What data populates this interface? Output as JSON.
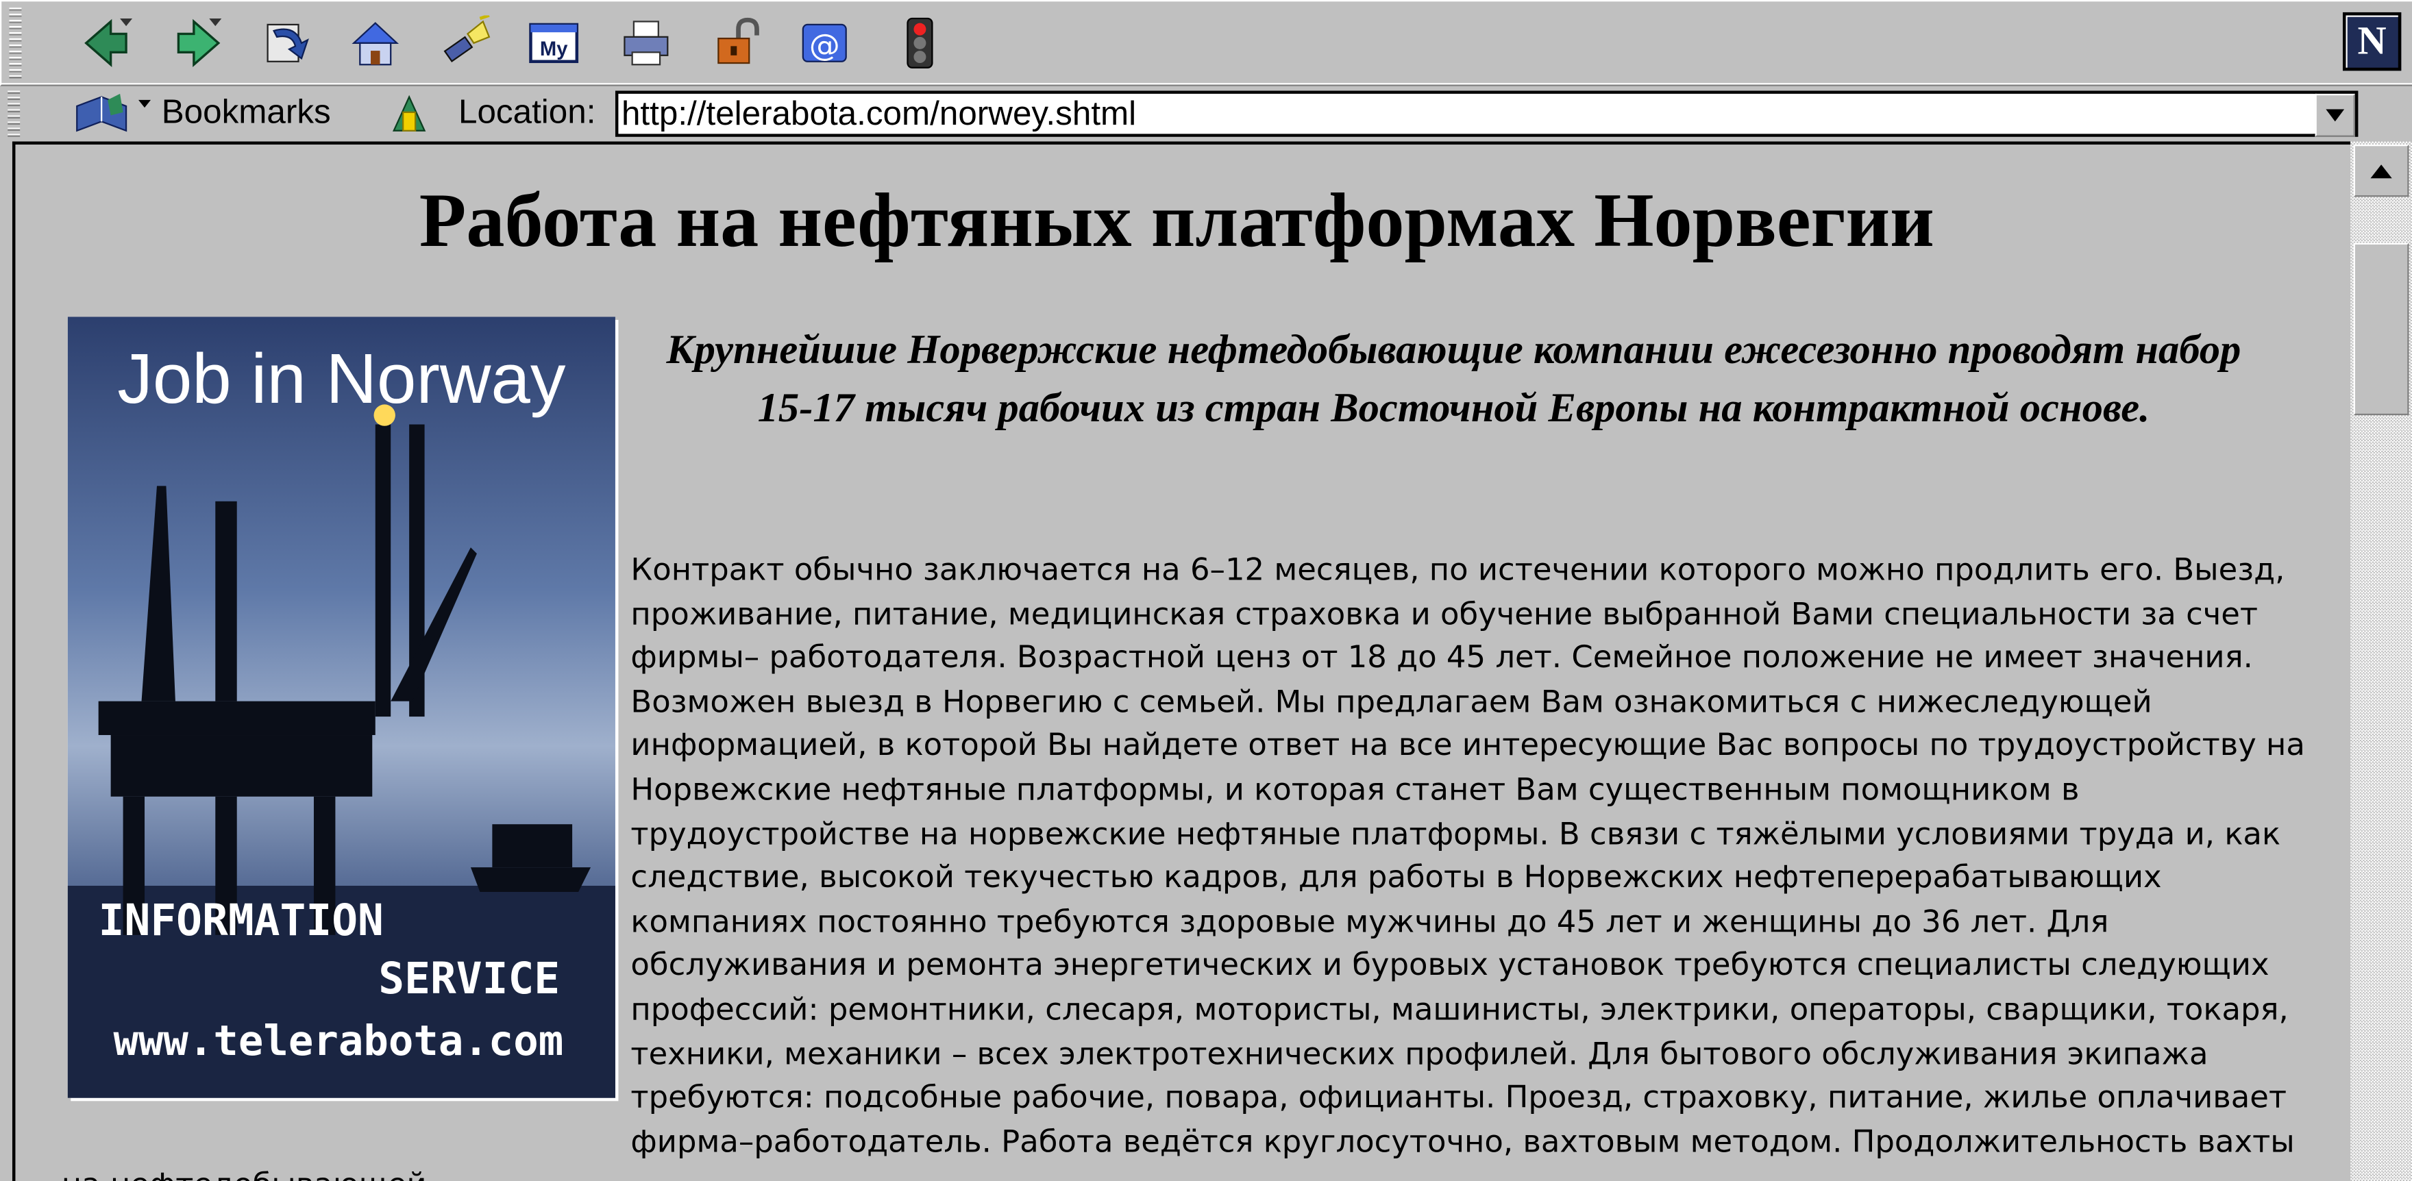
{
  "toolbar": {
    "buttons": [
      {
        "name": "back-button",
        "icon": "back-arrow-icon"
      },
      {
        "name": "forward-button",
        "icon": "forward-arrow-icon"
      },
      {
        "name": "reload-button",
        "icon": "reload-icon"
      },
      {
        "name": "home-button",
        "icon": "home-icon"
      },
      {
        "name": "search-button",
        "icon": "search-flashlight-icon"
      },
      {
        "name": "my-netscape-button",
        "icon": "my-netscape-icon"
      },
      {
        "name": "print-button",
        "icon": "printer-icon"
      },
      {
        "name": "security-button",
        "icon": "padlock-icon"
      },
      {
        "name": "shop-button",
        "icon": "at-sign-icon"
      },
      {
        "name": "stop-button",
        "icon": "traffic-light-icon"
      }
    ],
    "logo": "N",
    "my_label": "My"
  },
  "location_bar": {
    "bookmarks_label": "Bookmarks",
    "location_label": "Location:",
    "url": "http://telerabota.com/norwey.shtml"
  },
  "page": {
    "title": "Работа на нефтяных платформах Норвегии",
    "poster": {
      "headline": "Job in Norway",
      "line1": "INFORMATION",
      "line2": "SERVICE",
      "site": "www.telerabota.com"
    },
    "lead": "Крупнейшие Норвержские нефтедобывающие компании ежесезонно проводят набор 15-17 тысяч рабочих из стран Восточной Европы на контрактной основе.",
    "body": "Контракт обычно заключается на 6–12 месяцев, по истечении которого можно продлить его. Выезд, проживание, питание, медицинская страховка и обучение выбранной Вами специальности за счет фирмы– работодателя. Возрастной ценз от 18 до 45 лет. Семейное положение не имеет значения. Возможен выезд в Норвегию с семьей. Мы предлагаем Вам ознакомиться с нижеследующей информацией, в которой Вы найдете ответ на все интересующие Вас вопросы по трудоустройству на Норвежские нефтяные платформы, и которая станет Вам существенным помощником в трудоустройстве на норвежские нефтяные платформы. В связи с тяжёлыми условиями труда и, как следствие, высокой текучестью кадров, для работы в Норвежских нефтеперерабатывающих компаниях постоянно требуются здоровые мужчины до 45 лет и женщины до 36 лет. Для обслуживания и ремонта энергетических и буровых установок требуются специалисты следующих профессий: ремонтники, слесаря, мотористы, машинисты, электрики, операторы, сварщики, токаря, техники, механики – всех электротехнических профилей. Для бытового обслуживания экипажа требуются: подсобные рабочие, повара, официанты. Проезд, страховку, питание, жилье оплачивает фирма–работодатель. Работа ведётся круглосуточно, вахтовым методом. Продолжительность вахты на нефтедобывающей"
  }
}
